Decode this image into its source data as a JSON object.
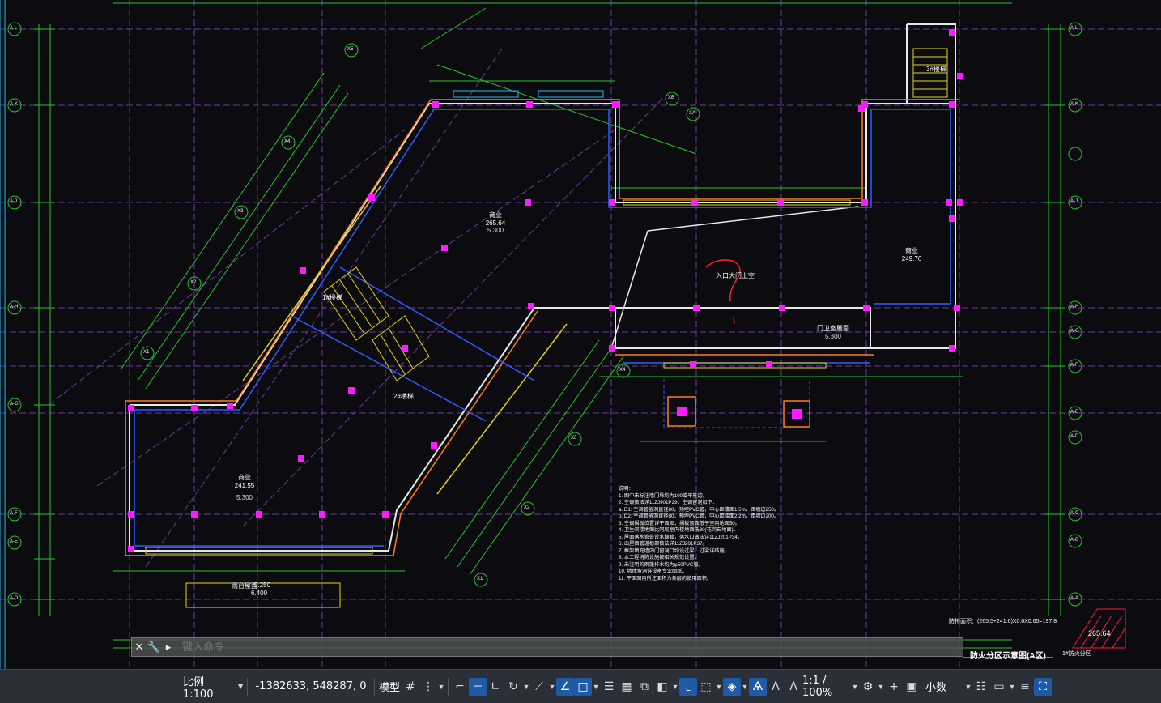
{
  "drawing": {
    "room_labels": [
      {
        "name": "商业",
        "area": "265.64",
        "elev": "5.300"
      },
      {
        "name": "商业",
        "area": "241.55",
        "elev": "5.300"
      },
      {
        "name": "商业",
        "area": "249.76",
        "elev": ""
      },
      {
        "name": "门卫室屋面",
        "area": "",
        "elev": "5.300"
      }
    ],
    "annotations": {
      "entrance": "入口大门上空",
      "stair1": "1#楼梯",
      "stair2": "2#楼梯",
      "stair3": "3#楼梯",
      "canopy": "雨台屋面",
      "canopy_elev": "5.250",
      "canopy_elev2": "6.400",
      "notes_title": "说明：",
      "area_calc": "防排面积：(265.5+241.6)X0.6X0.65=197.8",
      "zone_area": "265.64",
      "title_block": "防火分区示意图(A区)",
      "fire_zone": "1#防火分区"
    },
    "notes": [
      "1.  图中未标注墙门垛均为100或平柱边。",
      "2.  空调做法详11ZJ901P29，空调留洞如下：",
      "    a. D1: 空调管留洞直径80，预埋PVC管，中心距楼面1.5m，距墙边250。",
      "    b. D2: 空调管留洞直径80，预埋PVC管，中心距楼面2.2m，距墙边200。",
      "3.  空调搁板位置详平面图，搁板顶面低于室内地面50。",
      "4.  卫生间楼地面比同层室内楼地面低30(花岗石地面)。",
      "5.  屋面落水管处设水簸箕，落水口做法详11ZJ201P34。",
      "6.  出屋面管道根部做法详11ZJ201P37。",
      "7.  框架填充墙内门窗洞口均设过梁，过梁详结施。",
      "8.  本工程消防设施按相关规范设置。",
      "9.  未注明的雨篷排水均为φ50PVC管。",
      "10. 墙体留洞详设备专业图纸。",
      "11. 平面图内所注面积为各层的使用面积。"
    ],
    "axis_labels": [
      "A-L",
      "A-K",
      "A-J",
      "A-H",
      "A-G",
      "A-F",
      "A-E",
      "A-D",
      "A-C",
      "A-B",
      "A-A",
      "X1",
      "X2",
      "X3",
      "X4",
      "X5",
      "XA",
      "XB"
    ]
  },
  "command_line": {
    "placeholder": "键入命令"
  },
  "statusbar": {
    "scale": "比例 1:100",
    "coords": "-1382633, 548287, 0",
    "model": "模型",
    "annotation_scale": "1:1 / 100%",
    "units": "小数"
  }
}
